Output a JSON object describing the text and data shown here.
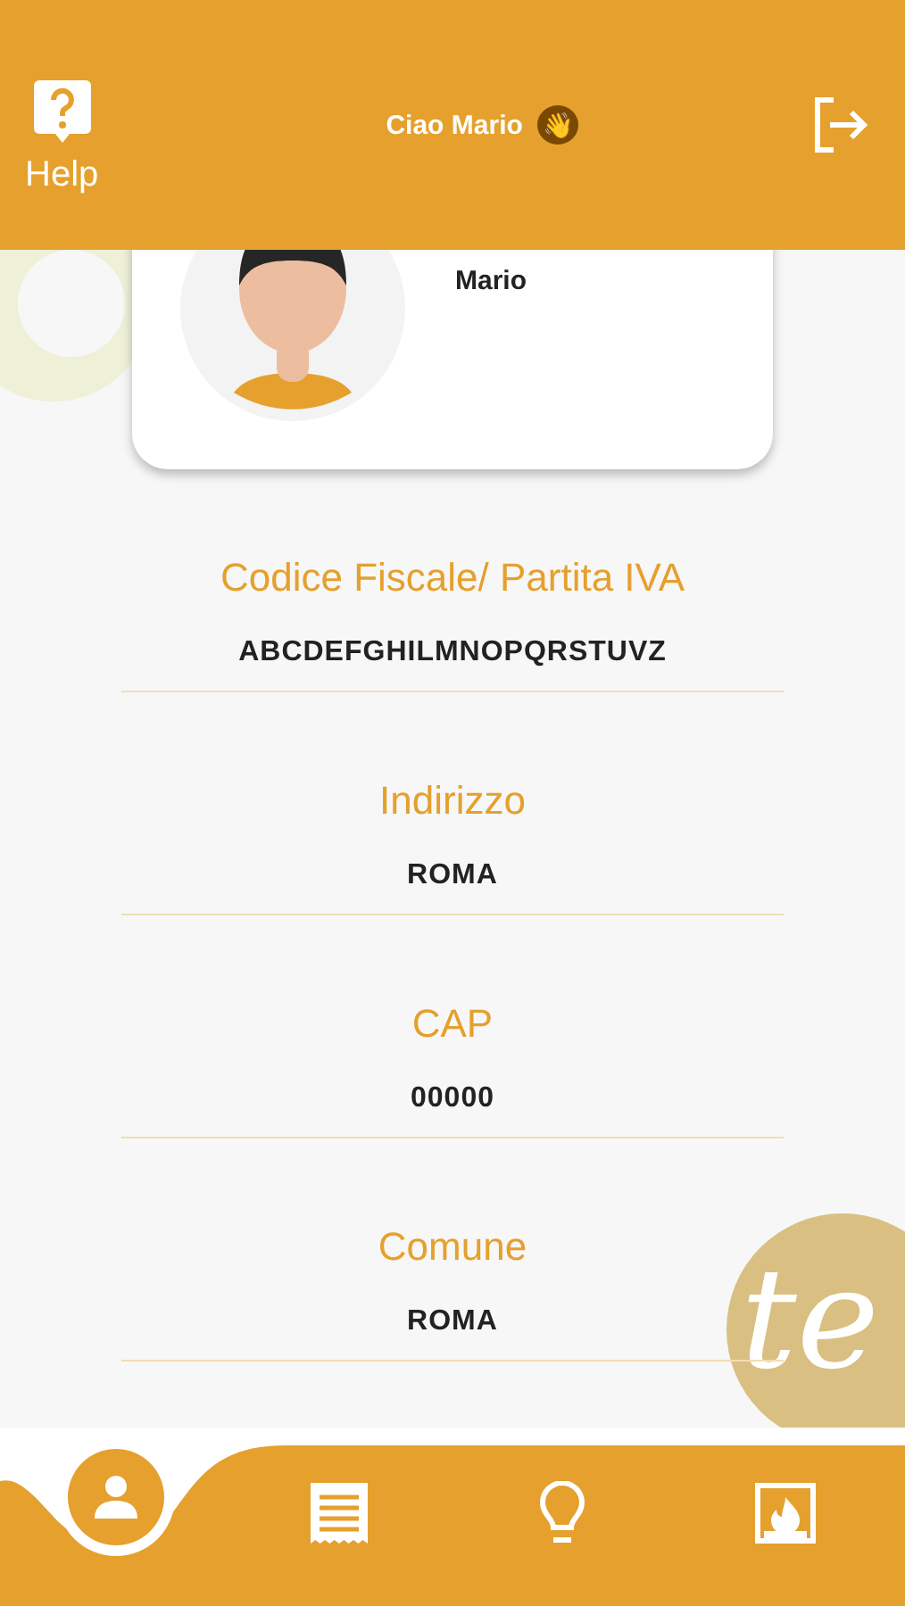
{
  "header": {
    "help_label": "Help",
    "greeting": "Ciao Mario",
    "greeting_emoji": "👋"
  },
  "profile": {
    "name": "Mario"
  },
  "fields": [
    {
      "label": "Codice Fiscale/ Partita IVA",
      "value": "ABCDEFGHILMNOPQRSTUVZ"
    },
    {
      "label": "Indirizzo",
      "value": "ROMA"
    },
    {
      "label": "CAP",
      "value": "00000"
    },
    {
      "label": "Comune",
      "value": "ROMA"
    }
  ],
  "logo_text": "te",
  "nav": [
    {
      "kind": "profile",
      "selected": true
    },
    {
      "kind": "receipt",
      "selected": false
    },
    {
      "kind": "bulb",
      "selected": false
    },
    {
      "kind": "fireplace",
      "selected": false
    }
  ]
}
